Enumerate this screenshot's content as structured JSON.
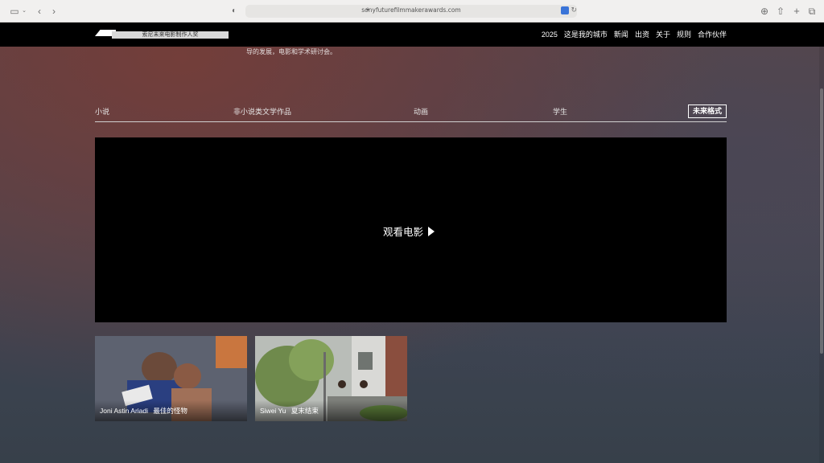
{
  "browser": {
    "url": "sonyfuturefilmmakerawards.com",
    "colors": {
      "toolbar": "#f1f0ef",
      "url_field": "#e6e5e3"
    }
  },
  "header": {
    "logo_text": "索尼未来电影制作人奖",
    "nav": [
      "2025",
      "这是我的城市",
      "新闻",
      "出资",
      "关于",
      "规则",
      "合作伙伴"
    ]
  },
  "intro": {
    "text": "导的发展，电影和学术研讨会。"
  },
  "tabs": {
    "items": [
      "小说",
      "非小说类文学作品",
      "动画",
      "学生"
    ],
    "active": "未来格式"
  },
  "video": {
    "watch_label": "观看电影",
    "play_icon": "play-icon"
  },
  "films": [
    {
      "director": "Joni Astin Ariadi",
      "title": "最佳的怪物"
    },
    {
      "director": "Siwei Yu",
      "title": "夏末结束"
    }
  ],
  "colors": {
    "header_bg": "#000000",
    "video_bg": "#000000",
    "text": "#ffffff"
  }
}
